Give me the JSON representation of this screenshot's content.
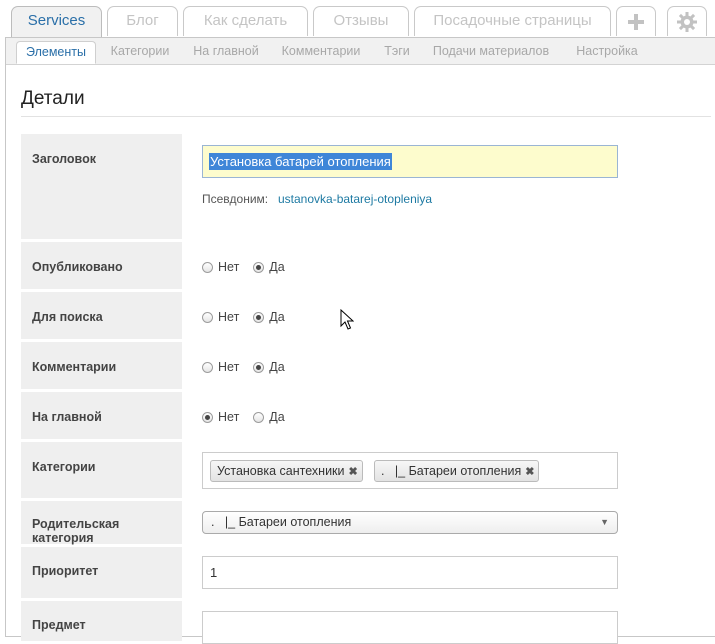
{
  "top_tabs": [
    {
      "label": "Services",
      "active": true
    },
    {
      "label": "Блог"
    },
    {
      "label": "Как сделать"
    },
    {
      "label": "Отзывы"
    },
    {
      "label": "Посадочные страницы"
    }
  ],
  "top_icons": [
    "plus-icon",
    "gear-icon"
  ],
  "sub_tabs": [
    {
      "label": "Элементы",
      "active": true
    },
    {
      "label": "Категории"
    },
    {
      "label": "На главной"
    },
    {
      "label": "Комментарии"
    },
    {
      "label": "Тэги"
    },
    {
      "label": "Подачи материалов"
    },
    {
      "label": "Настройка"
    }
  ],
  "section_title": "Детали",
  "fields": {
    "title": {
      "label": "Заголовок",
      "value": "Установка батарей отопления"
    },
    "alias": {
      "label": "Псевдоним:",
      "value": "ustanovka-batarej-otopleniya"
    },
    "published": {
      "label": "Опубликовано",
      "options": [
        "Нет",
        "Да"
      ],
      "selected": "Да"
    },
    "searchable": {
      "label": "Для поиска",
      "options": [
        "Нет",
        "Да"
      ],
      "selected": "Да"
    },
    "comments": {
      "label": "Комментарии",
      "options": [
        "Нет",
        "Да"
      ],
      "selected": "Да"
    },
    "frontpage": {
      "label": "На главной",
      "options": [
        "Нет",
        "Да"
      ],
      "selected": "Нет"
    },
    "categories": {
      "label": "Категории",
      "tokens": [
        "Установка сантехники",
        ".   |_ Батареи отопления"
      ]
    },
    "parent_category": {
      "label": "Родительская категория",
      "value": ".   |_ Батареи отопления"
    },
    "priority": {
      "label": "Приоритет",
      "value": "1"
    },
    "subject": {
      "label": "Предмет",
      "value": ""
    }
  },
  "colors": {
    "accent": "#2a6fa8",
    "link": "#1e7aa3",
    "title_input_bg": "#fdfccd",
    "selection": "#3f86d8",
    "label_bg": "#efefef"
  }
}
